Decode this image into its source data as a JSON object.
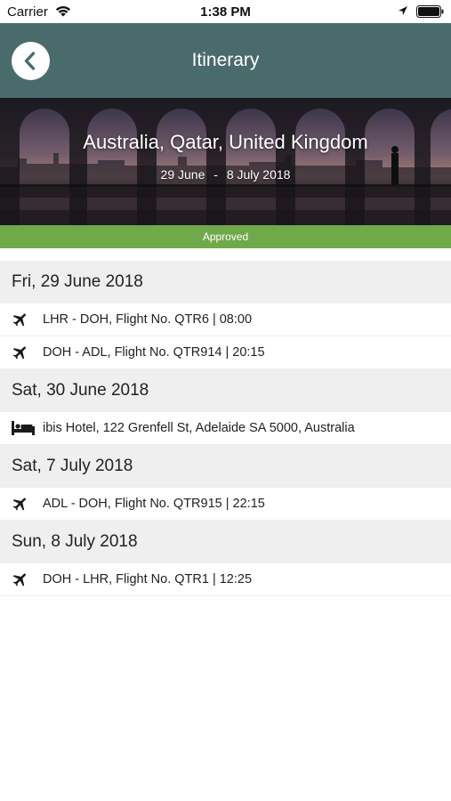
{
  "status_bar": {
    "carrier": "Carrier",
    "time": "1:38 PM"
  },
  "nav": {
    "title": "Itinerary"
  },
  "hero": {
    "title": "Australia, Qatar, United Kingdom",
    "start_date": "29 June",
    "separator": "-",
    "end_date": "8 July 2018"
  },
  "status": {
    "label": "Approved",
    "color": "#6fa94a"
  },
  "colors": {
    "nav_bg": "#4a6b6b",
    "section_bg": "#efefef"
  },
  "days": [
    {
      "date": "Fri, 29 June 2018",
      "items": [
        {
          "icon": "airplane-icon",
          "text": "LHR - DOH, Flight No. QTR6 | 08:00"
        },
        {
          "icon": "airplane-icon",
          "text": "DOH - ADL, Flight No. QTR914 | 20:15"
        }
      ]
    },
    {
      "date": "Sat, 30 June 2018",
      "items": [
        {
          "icon": "bed-icon",
          "text": "ibis Hotel, 122 Grenfell St, Adelaide SA 5000, Australia"
        }
      ]
    },
    {
      "date": "Sat, 7 July 2018",
      "items": [
        {
          "icon": "airplane-icon",
          "text": "ADL - DOH, Flight No. QTR915 | 22:15"
        }
      ]
    },
    {
      "date": "Sun, 8 July 2018",
      "items": [
        {
          "icon": "airplane-icon",
          "text": "DOH - LHR, Flight No. QTR1 | 12:25"
        }
      ]
    }
  ]
}
